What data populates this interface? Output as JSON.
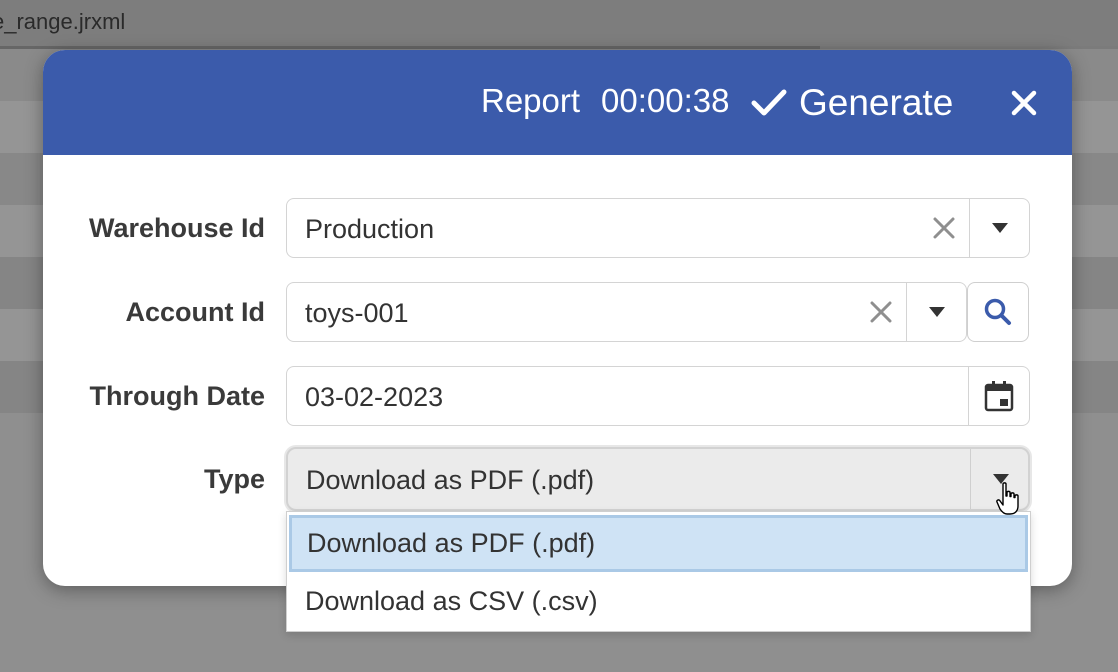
{
  "background": {
    "file_title": "e_range.jrxml"
  },
  "dialog": {
    "header": {
      "report_label": "Report",
      "timer": "00:00:38",
      "generate_label": "Generate"
    },
    "fields": {
      "warehouse": {
        "label": "Warehouse Id",
        "value": "Production"
      },
      "account": {
        "label": "Account Id",
        "value": "toys-001"
      },
      "through_date": {
        "label": "Through Date",
        "value": "03-02-2023"
      },
      "type": {
        "label": "Type",
        "value": "Download as PDF (.pdf)"
      }
    },
    "type_options": [
      {
        "label": "Download as PDF (.pdf)",
        "selected": true
      },
      {
        "label": "Download as CSV (.csv)",
        "selected": false
      }
    ]
  },
  "colors": {
    "header_bg": "#3b5bab",
    "selected_option_bg": "#cfe3f5",
    "overlay": "#7b7b7b"
  }
}
